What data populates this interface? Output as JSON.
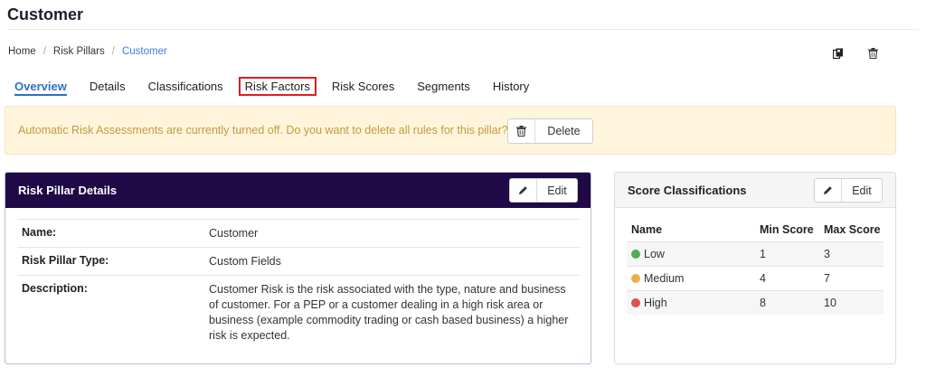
{
  "page": {
    "title": "Customer"
  },
  "breadcrumb": {
    "items": [
      "Home",
      "Risk Pillars",
      "Customer"
    ]
  },
  "tabs": [
    "Overview",
    "Details",
    "Classifications",
    "Risk Factors",
    "Risk Scores",
    "Segments",
    "History"
  ],
  "alert": {
    "text": "Automatic Risk Assessments are currently turned off. Do you want to delete all rules for this pillar?",
    "button_label": "Delete"
  },
  "details_panel": {
    "title": "Risk Pillar Details",
    "edit_label": "Edit",
    "rows": [
      {
        "key": "Name:",
        "value": "Customer"
      },
      {
        "key": "Risk Pillar Type:",
        "value": "Custom Fields"
      },
      {
        "key": "Description:",
        "value": "Customer Risk is the risk associated with the type, nature and business of customer. For a PEP or a customer dealing in a high risk area or business (example commodity trading or cash based business) a higher risk is expected."
      }
    ]
  },
  "score_panel": {
    "title": "Score Classifications",
    "edit_label": "Edit",
    "columns": [
      "Name",
      "Min Score",
      "Max Score"
    ],
    "rows": [
      {
        "name": "Low",
        "min": "1",
        "max": "3",
        "color": "#4caf50"
      },
      {
        "name": "Medium",
        "min": "4",
        "max": "7",
        "color": "#f0ad4e"
      },
      {
        "name": "High",
        "min": "8",
        "max": "10",
        "color": "#d9534f"
      }
    ]
  },
  "colors": {
    "accent": "#2f6fc6",
    "header_dark": "#1f0a47",
    "highlight_border": "#e01b22",
    "alert_bg": "#fff5dc",
    "alert_text": "#c49a3b"
  },
  "icons": {
    "copy": "copy-icon",
    "trash": "trash-icon",
    "pencil": "pencil-icon"
  }
}
